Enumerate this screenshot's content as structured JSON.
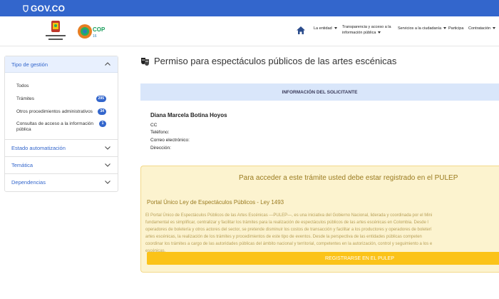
{
  "govbar": {
    "brand": "GOV.CO"
  },
  "header": {
    "logo_cali_text": "ALCALDÍA DE SANTIAGO DE CALI",
    "logo_cop_text": "COP16",
    "nav": [
      {
        "label": "La entidad",
        "has_caret": true
      },
      {
        "label": "Transparencia y acceso a la información pública",
        "has_caret": true
      },
      {
        "label": "Servicios a la ciudadanía",
        "has_caret": true
      },
      {
        "label": "Participa",
        "has_caret": false
      },
      {
        "label": "Contratación",
        "has_caret": true
      }
    ]
  },
  "sidebar": {
    "header": "Tipo de gestión",
    "items": [
      {
        "label": "Todos",
        "count": ""
      },
      {
        "label": "Trámites",
        "count": "295"
      },
      {
        "label": "Otros procedimientos administrativos",
        "count": "34"
      },
      {
        "label": "Consultas de acceso a la información pública",
        "count": "1"
      }
    ],
    "sections": [
      "Estado automatización",
      "Temática",
      "Dependencias"
    ]
  },
  "main": {
    "title": "Permiso para espectáculos públicos de las artes escénicas",
    "applicant": {
      "header": "INFORMACIÓN DEL SOLICITANTE",
      "name": "Diana Marcela Botina Hoyos",
      "doc": "CC",
      "phone_label": "Teléfono:",
      "email_label": "Correo electrónico:",
      "address_label": "Dirección:"
    },
    "alert": {
      "title": "Para acceder a este trámite usted debe estar registrado en el PULEP",
      "subtitle": "Portal Único Ley de Espectáculos Públicos - Ley 1493",
      "lines": [
        "El Portal Único de Espectáculos Públicos de las Artes Escénicas —PULEP—, es una iniciativa del Gobierno Nacional, liderada y coordinada por el Mini",
        "fundamental es simplificar, centralizar y facilitar los trámites para la realización de espectáculos públicos de las artes escénicas en Colombia. Desde l",
        "operadores de boletería y otros actores del sector, se pretende disminuir los costos de transacción y facilitar a los productores y operadores de boleterí",
        "artes escénicas, la realización de los trámites y procedimientos de este tipo de eventos. Desde la perspectiva de las entidades públicas competen",
        "coordinar los trámites a cargo de las autoridades públicas del ámbito nacional y territorial, competentes en la autorización, control y seguimiento a los e",
        "escénicas."
      ],
      "button": "REGISTRARSE EN EL PULEP"
    }
  },
  "colors": {
    "primary": "#3366cc",
    "alert_bg": "#fcf3cf",
    "button": "#fbc319"
  }
}
